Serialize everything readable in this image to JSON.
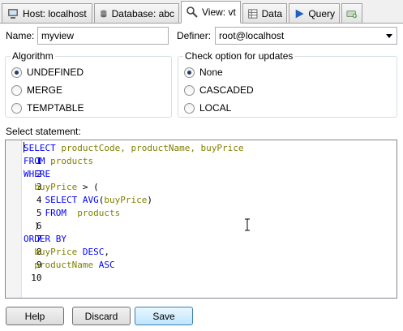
{
  "tabs": [
    {
      "label": "Host: localhost",
      "icon": "host-icon"
    },
    {
      "label": "Database: abc",
      "icon": "database-icon"
    },
    {
      "label": "View: vt",
      "icon": "view-icon",
      "active": true
    },
    {
      "label": "Data",
      "icon": "data-grid-icon"
    },
    {
      "label": "Query",
      "icon": "query-play-icon"
    },
    {
      "label": "",
      "icon": "new-tab-icon"
    }
  ],
  "form": {
    "name_label": "Name:",
    "name_value": "myview",
    "definer_label": "Definer:",
    "definer_value": "root@localhost"
  },
  "algorithm": {
    "title": "Algorithm",
    "options": [
      "UNDEFINED",
      "MERGE",
      "TEMPTABLE"
    ],
    "selected": "UNDEFINED"
  },
  "check_option": {
    "title": "Check option for updates",
    "options": [
      "None",
      "CASCADED",
      "LOCAL"
    ],
    "selected": "None"
  },
  "editor": {
    "label": "Select statement:",
    "line_numbers": [
      "1",
      "2",
      "3",
      "4",
      "5",
      "6",
      "7",
      "8",
      "9",
      "10"
    ],
    "tokens": {
      "l1": [
        "SELECT",
        " productCode, productName, buyPrice"
      ],
      "l2": [
        "FROM",
        " products"
      ],
      "l3": [
        "WHERE"
      ],
      "l4": [
        "  buyPrice",
        " > ("
      ],
      "l5": [
        "    SELECT AVG",
        "(",
        "buyPrice",
        ")"
      ],
      "l6": [
        "    FROM",
        "  products"
      ],
      "l7": [
        "  )"
      ],
      "l8": [
        "ORDER BY"
      ],
      "l9": [
        "  buyPrice",
        " DESC",
        ","
      ],
      "l10": [
        "  productName",
        " ASC"
      ]
    }
  },
  "buttons": {
    "help": "Help",
    "discard": "Discard",
    "save": "Save"
  },
  "colors": {
    "keyword": "#0000ff",
    "identifier": "#808000"
  }
}
